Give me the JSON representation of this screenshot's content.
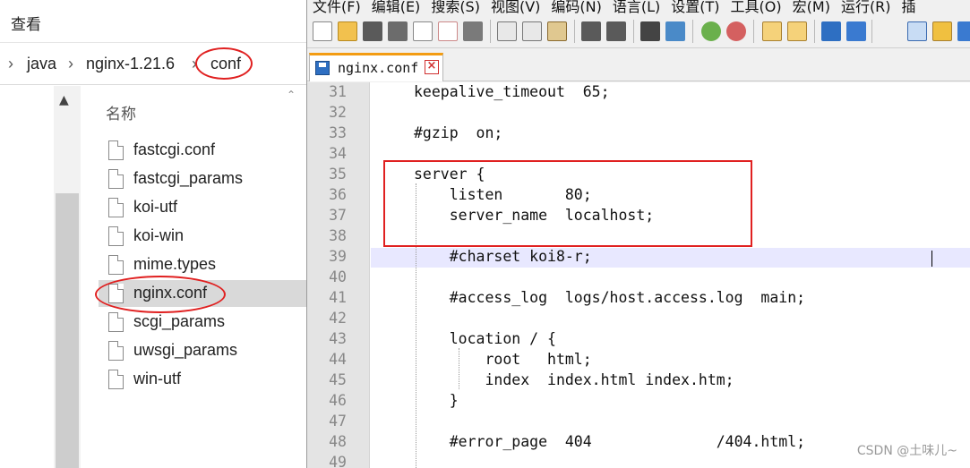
{
  "explorer": {
    "ribbon_label": "查看",
    "breadcrumb": [
      "java",
      "nginx-1.21.6",
      "conf"
    ],
    "column_header": "名称",
    "files": [
      "fastcgi.conf",
      "fastcgi_params",
      "koi-utf",
      "koi-win",
      "mime.types",
      "nginx.conf",
      "scgi_params",
      "uwsgi_params",
      "win-utf"
    ],
    "selected_file": "nginx.conf",
    "annotation_color": "#e02020"
  },
  "npp": {
    "menu": [
      "文件(F)",
      "编辑(E)",
      "搜索(S)",
      "视图(V)",
      "编码(N)",
      "语言(L)",
      "设置(T)",
      "工具(O)",
      "宏(M)",
      "运行(R)",
      "插"
    ],
    "tab_label": "nginx.conf",
    "toolbar_icons": [
      "new-file-icon",
      "open-file-icon",
      "save-icon",
      "save-all-icon",
      "close-icon",
      "close-all-icon",
      "print-icon",
      "cut-icon",
      "copy-icon",
      "paste-icon",
      "undo-icon",
      "redo-icon",
      "find-icon",
      "replace-icon",
      "zoom-in-icon",
      "zoom-out-icon",
      "sync-vertical-icon",
      "sync-horizontal-icon",
      "word-wrap-icon",
      "show-all-chars-icon",
      "indent-guide-icon",
      "doc-map-icon",
      "monitor-icon"
    ],
    "line_numbers": [
      "31",
      "32",
      "33",
      "34",
      "35",
      "36",
      "37",
      "38",
      "39",
      "40",
      "41",
      "42",
      "43",
      "44",
      "45",
      "46",
      "47",
      "48",
      "49"
    ],
    "lines": [
      "keepalive_timeout  65;",
      "",
      "#gzip  on;",
      "",
      "server {",
      "    listen       80;",
      "    server_name  localhost;",
      "",
      "    #charset koi8-r;",
      "",
      "    #access_log  logs/host.access.log  main;",
      "",
      "    location / {",
      "        root   html;",
      "        index  index.html index.htm;",
      "    }",
      "",
      "    #error_page  404              /404.html;",
      ""
    ],
    "current_line": "39",
    "accent_color": "#f39c12"
  },
  "watermark": "CSDN @土味儿~"
}
